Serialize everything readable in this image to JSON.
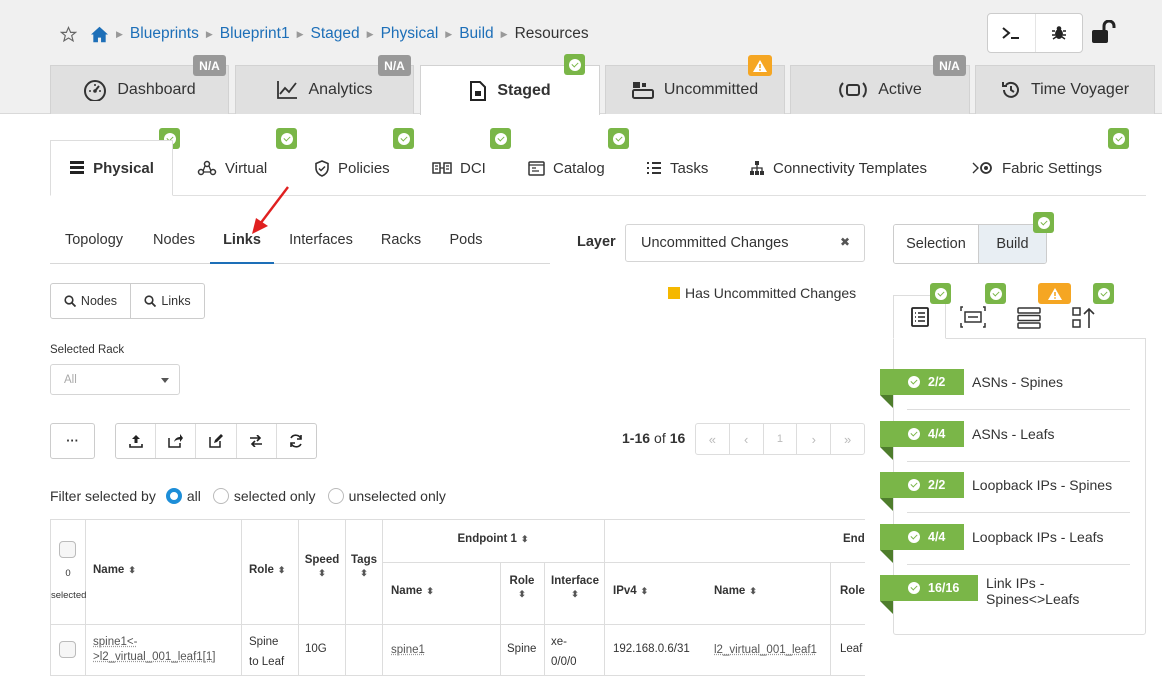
{
  "breadcrumb": {
    "items": [
      "Blueprints",
      "Blueprint1",
      "Staged",
      "Physical",
      "Build"
    ],
    "current": "Resources"
  },
  "main_tabs": [
    {
      "label": "Dashboard",
      "badge": "N/A"
    },
    {
      "label": "Analytics",
      "badge": "N/A"
    },
    {
      "label": "Staged",
      "badge": "ok"
    },
    {
      "label": "Uncommitted",
      "badge": "warn"
    },
    {
      "label": "Active",
      "badge": "N/A"
    },
    {
      "label": "Time Voyager",
      "badge": ""
    }
  ],
  "sub_tabs": [
    "Physical",
    "Virtual",
    "Policies",
    "DCI",
    "Catalog",
    "Tasks",
    "Connectivity Templates",
    "Fabric Settings"
  ],
  "view_tabs": [
    "Topology",
    "Nodes",
    "Links",
    "Interfaces",
    "Racks",
    "Pods"
  ],
  "layer": {
    "label": "Layer",
    "value": "Uncommitted Changes",
    "clear": "✖"
  },
  "legend": {
    "uncommitted": "Has Uncommitted Changes",
    "color": "#f5b800"
  },
  "search_buttons": {
    "nodes": "Nodes",
    "links": "Links"
  },
  "selected_rack": {
    "label": "Selected Rack",
    "value": "All"
  },
  "toolbar": {
    "more": "···"
  },
  "pagination": {
    "range": "1-16",
    "of": "of",
    "total": "16",
    "page": "1",
    "first": "«",
    "prev": "‹",
    "next": "›",
    "last": "»"
  },
  "filter": {
    "label": "Filter selected by",
    "options": [
      "all",
      "selected only",
      "unselected only"
    ],
    "selected": "all"
  },
  "table": {
    "selected_count": "0",
    "selected_label": "selected",
    "headers": {
      "name": "Name",
      "role": "Role",
      "speed": "Speed",
      "tags": "Tags",
      "endpoint1": "Endpoint 1",
      "endpoint2": "Endp",
      "ep_name": "Name",
      "ep_role": "Role",
      "ep_interface": "Interface",
      "ep_ipv4": "IPv4",
      "ep2_name": "Name",
      "ep2_role": "Role"
    },
    "sort_glyph": "⬍",
    "rows": [
      {
        "name_line1": "spine1<-",
        "name_line2": ">l2_virtual_001_leaf1[1]",
        "role_line1": "Spine",
        "role_line2": "to Leaf",
        "speed": "10G",
        "ep1_name": "spine1",
        "ep1_role": "Spine",
        "ep1_if_line1": "xe-",
        "ep1_if_line2": "0/0/0",
        "ep1_ipv4": "192.168.0.6/31",
        "ep2_name": "l2_virtual_001_leaf1",
        "ep2_role": "Leaf"
      }
    ]
  },
  "right_panel": {
    "tabs": [
      "Selection",
      "Build"
    ],
    "resources": [
      {
        "count": "2/2",
        "label": "ASNs - Spines"
      },
      {
        "count": "4/4",
        "label": "ASNs - Leafs"
      },
      {
        "count": "2/2",
        "label": "Loopback IPs - Spines"
      },
      {
        "count": "4/4",
        "label": "Loopback IPs - Leafs"
      },
      {
        "count": "16/16",
        "label_line1": "Link IPs -",
        "label_line2": "Spines<>Leafs"
      }
    ]
  },
  "colors": {
    "link": "#1d6fb8",
    "ok": "#7ab648",
    "warn": "#f5a623",
    "na": "#999999",
    "arrow": "#e02020"
  }
}
